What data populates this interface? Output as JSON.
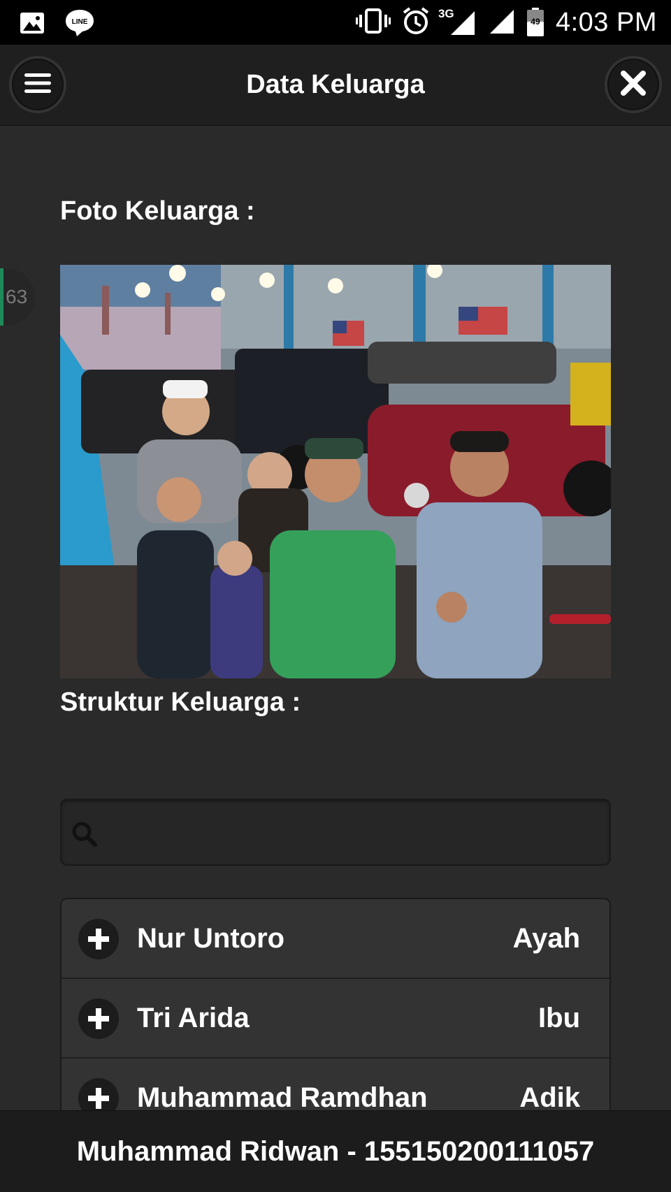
{
  "statusbar": {
    "icons_left": [
      "image-icon",
      "line-app-icon"
    ],
    "line_label": "LINE",
    "network": "3G",
    "battery": "49",
    "time": "4:03 PM"
  },
  "header": {
    "title": "Data Keluarga",
    "menu_icon": "hamburger-icon",
    "close_icon": "close-icon"
  },
  "side_badge": "63",
  "photo_section": {
    "title": "Foto Keluarga :"
  },
  "structure_section": {
    "title": "Struktur Keluarga :",
    "search": {
      "value": "",
      "placeholder": ""
    }
  },
  "members": [
    {
      "name": "Nur Untoro",
      "role": "Ayah"
    },
    {
      "name": "Tri Arida",
      "role": "Ibu"
    },
    {
      "name": "Muhammad Ramdhan",
      "role": "Adik"
    }
  ],
  "footer": {
    "text": "Muhammad Ridwan - 155150200111057"
  },
  "colors": {
    "background": "#2a2a2a",
    "header": "#1f1f1f",
    "list_item": "#333333",
    "accent": "#1e8a5a"
  }
}
